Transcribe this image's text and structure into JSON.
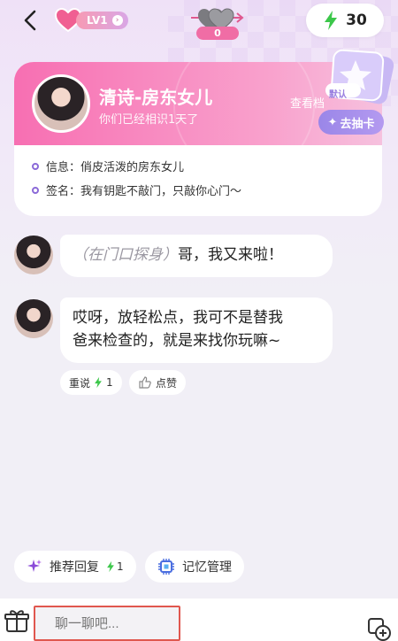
{
  "header": {
    "level": "LV1",
    "hearts_count": "0",
    "energy": "30"
  },
  "profile": {
    "name": "清诗-房东女儿",
    "since": "你们已经相识1天了",
    "view_file": "查看档",
    "card_badge": "默认",
    "draw_card": "去抽卡",
    "info_label": "信息：",
    "info_value": "俏皮活泼的房东女儿",
    "sign_label": "签名：",
    "sign_value": "我有钥匙不敲门，只敲你心门～"
  },
  "chat": {
    "messages": [
      {
        "action": "（在门口探身）",
        "text": "哥，我又来啦！"
      },
      {
        "line1": "哎呀，放轻松点，我可不是替我",
        "line2": "爸来检查的，就是来找你玩嘛~"
      }
    ],
    "retry": "重说",
    "retry_cost": "1",
    "like": "点赞"
  },
  "actions": {
    "recommend": "推荐回复",
    "recommend_cost": "1",
    "memory": "记忆管理"
  },
  "input": {
    "placeholder": "聊一聊吧..."
  },
  "colors": {
    "accent_pink": "#f76fb2",
    "energy_green": "#3cc74a",
    "purple": "#8b6ad8",
    "input_border": "#e0574e"
  }
}
